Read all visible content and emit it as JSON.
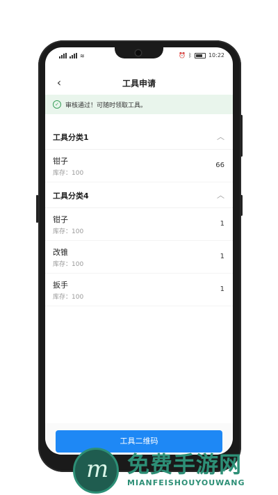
{
  "status_bar": {
    "time": "10:22",
    "signal_left": "46 46"
  },
  "header": {
    "title": "工具申请",
    "back_icon": "chevron-left-icon"
  },
  "notice": {
    "text": "审核通过！可随时领取工具。",
    "color": "#3aa05b"
  },
  "groups": [
    {
      "title": "工具分类1",
      "items": [
        {
          "name": "钳子",
          "stock": "库存：100",
          "qty": "66"
        }
      ]
    },
    {
      "title": "工具分类4",
      "items": [
        {
          "name": "钳子",
          "stock": "库存：100",
          "qty": "1"
        },
        {
          "name": "改锥",
          "stock": "库存：100",
          "qty": "1"
        },
        {
          "name": "扳手",
          "stock": "库存：100",
          "qty": "1"
        }
      ]
    }
  ],
  "footer": {
    "button_label": "工具二维码",
    "accent": "#1e88f5"
  },
  "watermark": {
    "title": "免费手游网",
    "subtitle": "MIANFEISHOUYOUWANG"
  }
}
